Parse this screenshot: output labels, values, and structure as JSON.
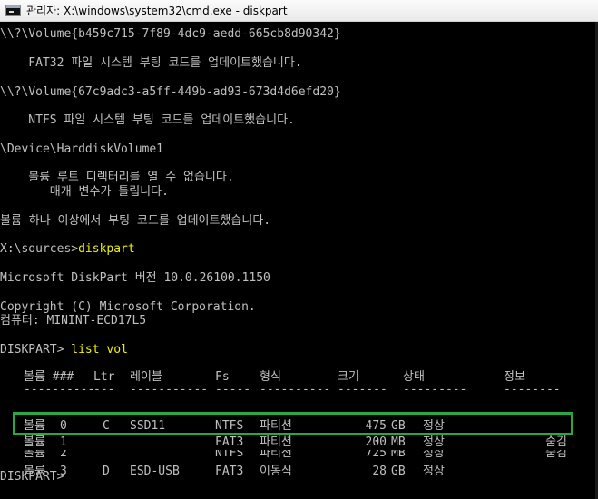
{
  "window": {
    "title": "관리자: X:\\windows\\system32\\cmd.exe - diskpart"
  },
  "console": {
    "lines": [
      "\\\\?\\Volume{b459c715-7f89-4dc9-aedd-665cb8d90342}",
      "    FAT32 파일 시스템 부팅 코드를 업데이트했습니다.",
      "\\\\?\\Volume{67c9adc3-a5ff-449b-ad93-673d4d6efd20}",
      "    NTFS 파일 시스템 부팅 코드를 업데이트했습니다.",
      "\\Device\\HarddiskVolume1",
      "    볼륨 루트 디렉터리를 열 수 없습니다.",
      "       매개 변수가 틀립니다.",
      "볼륨 하나 이상에서 부팅 코드를 업데이트했습니다.",
      "X:\\sources>",
      "diskpart",
      "Microsoft DiskPart 버전 10.0.26100.1150",
      "Copyright (C) Microsoft Corporation.",
      "컴퓨터: MININT-ECD17L5",
      "DISKPART> ",
      "list vol",
      "DISKPART>"
    ]
  },
  "volume_table": {
    "headers": {
      "volume": "볼륨 ###",
      "ltr": "Ltr",
      "label": "레이블",
      "fs": "Fs",
      "type": "형식",
      "size": "크기",
      "state": "상태",
      "info": "정보"
    },
    "separators": {
      "volume": "----------",
      "ltr": "---",
      "label": "-----------",
      "fs": "-----",
      "type": "----------",
      "size": "-------",
      "state": "---------",
      "info": "--------"
    },
    "rows": [
      {
        "vol": "볼륨",
        "num": "0",
        "ltr": "C",
        "label": "SSD11",
        "fs": "NTFS",
        "type": "파티션",
        "size": "475",
        "unit": "GB",
        "state": "정상",
        "info": ""
      },
      {
        "vol": "볼륨",
        "num": "1",
        "ltr": "",
        "label": "",
        "fs": "FAT3",
        "type": "파티션",
        "size": "200",
        "unit": "MB",
        "state": "정상",
        "info": "숨김"
      },
      {
        "vol": "볼륨",
        "num": "2",
        "ltr": "",
        "label": "",
        "fs": "NTFS",
        "type": "파티션",
        "size": "725",
        "unit": "MB",
        "state": "정상",
        "info": "숨김"
      },
      {
        "vol": "볼륨",
        "num": "3",
        "ltr": "D",
        "label": "ESD-USB",
        "fs": "FAT3",
        "type": "이동식",
        "size": "28",
        "unit": "GB",
        "state": "정상",
        "info": ""
      }
    ]
  },
  "colors": {
    "console_bg": "#000000",
    "console_text": "#c0c0c0",
    "input_text": "#f0f000",
    "highlight": "#28a745"
  }
}
